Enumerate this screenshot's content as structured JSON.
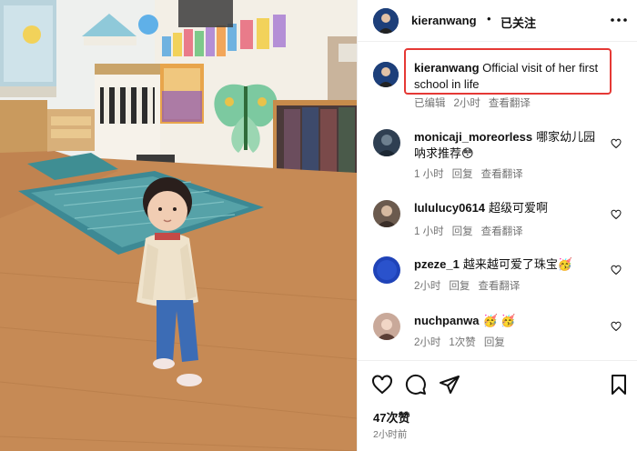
{
  "post": {
    "author": "kieranwang",
    "separator": "•",
    "follow_label": "已关注",
    "caption_user": "kieranwang",
    "caption_text": "Official visit of her first school in life",
    "caption_meta": [
      "已编辑",
      "2小时",
      "查看翻译"
    ],
    "likes": "47次赞",
    "posted_time": "2小时前"
  },
  "comments": [
    {
      "user": "monicaji_moreorless",
      "text": "哪家幼儿园呐求推荐😳",
      "meta": [
        "1 小时",
        "回复",
        "查看翻译"
      ],
      "avatar_color": "#2f3f52"
    },
    {
      "user": "lululucy0614",
      "text": "超级可爱啊",
      "meta": [
        "1 小时",
        "回复",
        "查看翻译"
      ],
      "avatar_color": "#6b5a4e"
    },
    {
      "user": "pzeze_1",
      "text": "越来越可爱了珠宝🥳",
      "meta": [
        "2小时",
        "回复",
        "查看翻译"
      ],
      "avatar_color": "#1f43b8"
    },
    {
      "user": "nuchpanwa",
      "text": "🥳 🥳",
      "meta": [
        "2小时",
        "1次赞",
        "回复"
      ],
      "avatar_color": "#c9a99a"
    }
  ],
  "icons": {
    "more": "more-options-icon",
    "like": "heart-icon",
    "comment": "comment-bubble-icon",
    "share": "send-icon",
    "save": "bookmark-icon"
  }
}
